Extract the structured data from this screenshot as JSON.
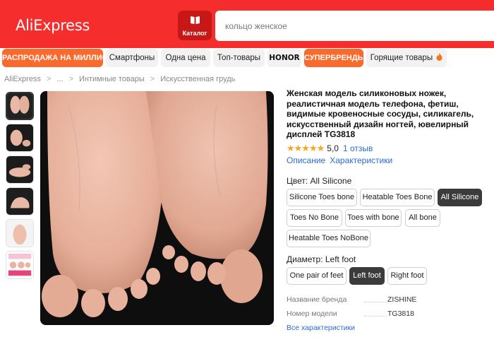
{
  "header": {
    "logo": "AliExpress",
    "catalog_label": "Каталог",
    "search_placeholder": "кольцо женское"
  },
  "categories": [
    {
      "label": "РАСПРОДАЖА НА МИЛЛИОН",
      "kind": "promo"
    },
    {
      "label": "Смартфоны",
      "kind": "plain"
    },
    {
      "label": "Одна цена",
      "kind": "plain"
    },
    {
      "label": "Топ-товары",
      "kind": "plain"
    },
    {
      "label": "HONOR",
      "kind": "brand"
    },
    {
      "label": "СУПЕРБРЕНДЫ",
      "kind": "promo"
    },
    {
      "label": "Горящие товары",
      "kind": "plain",
      "icon": "fire-icon"
    }
  ],
  "breadcrumb": [
    "AliExpress",
    "...",
    "Интимные товары",
    "Искусственная грудь"
  ],
  "product": {
    "title": "Женская модель силиконовых ножек, реалистичная модель телефона, фетиш, видимые кровеносные сосуды, силикагель, искусственный дизайн ногтей, ювелирный дисплей TG3818",
    "stars": "★★★★★",
    "rating": "5,0",
    "reviews": "1 отзыв",
    "link_description": "Описание",
    "link_specs": "Характеристики"
  },
  "color": {
    "label": "Цвет: All Silicone",
    "options": [
      "Silicone Toes bone",
      "Heatable Toes Bone",
      "All Silicone",
      "Toes No Bone",
      "Toes with bone",
      "All bone",
      "Heatable Toes NoBone"
    ],
    "selected": "All Silicone"
  },
  "diameter": {
    "label": "Диаметр: Left foot",
    "options": [
      "One pair of feet",
      "Left foot",
      "Right foot"
    ],
    "selected": "Left foot"
  },
  "specs": [
    {
      "key": "Название бренда",
      "value": "ZISHINE"
    },
    {
      "key": "Номер модели",
      "value": "TG3818"
    }
  ],
  "all_specs_link": "Все характеристики",
  "colors": {
    "header_red": "#f52d2d",
    "catalog_red": "#c81717",
    "promo_orange": "#fa6a2c",
    "link_blue": "#2c6ad8",
    "star_gold": "#f5a623",
    "selected_dark": "#3b3b3b"
  }
}
